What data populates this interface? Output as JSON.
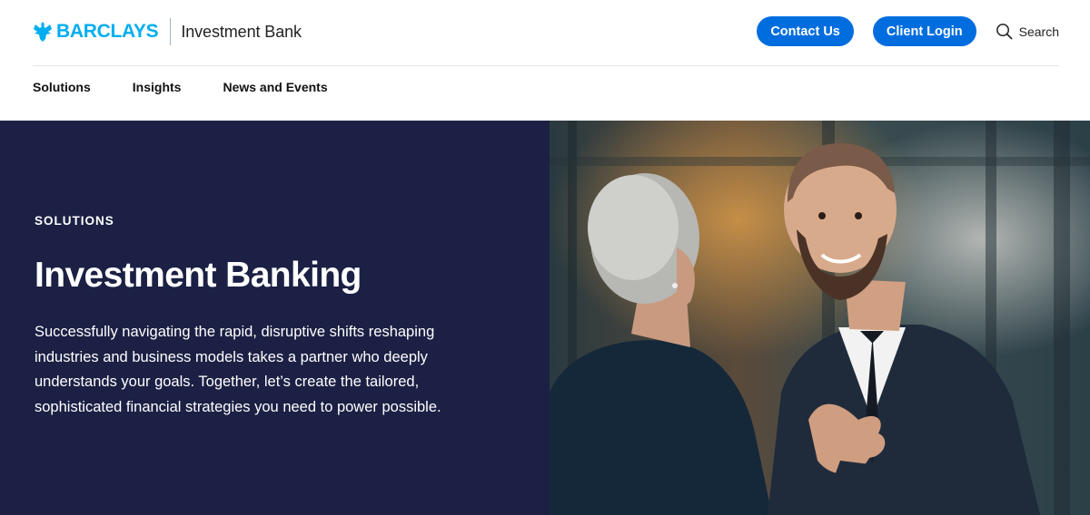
{
  "brand": {
    "wordmark": "BARCLAYS",
    "division": "Investment Bank",
    "logo_icon": "eagle-icon",
    "color": "#00aeef"
  },
  "header": {
    "contact_label": "Contact Us",
    "login_label": "Client Login",
    "search_label": "Search",
    "search_icon": "search-icon",
    "button_color": "#006ddf"
  },
  "nav": {
    "items": [
      {
        "label": "Solutions"
      },
      {
        "label": "Insights"
      },
      {
        "label": "News and Events"
      }
    ]
  },
  "hero": {
    "eyebrow": "SOLUTIONS",
    "title": "Investment Banking",
    "body": "Successfully navigating the rapid, disruptive shifts reshaping industries and business models takes a partner who deeply understands your goals. Together, let’s create the tailored, sophisticated financial strategies you need to power possible.",
    "panel_color": "#1b2044"
  }
}
